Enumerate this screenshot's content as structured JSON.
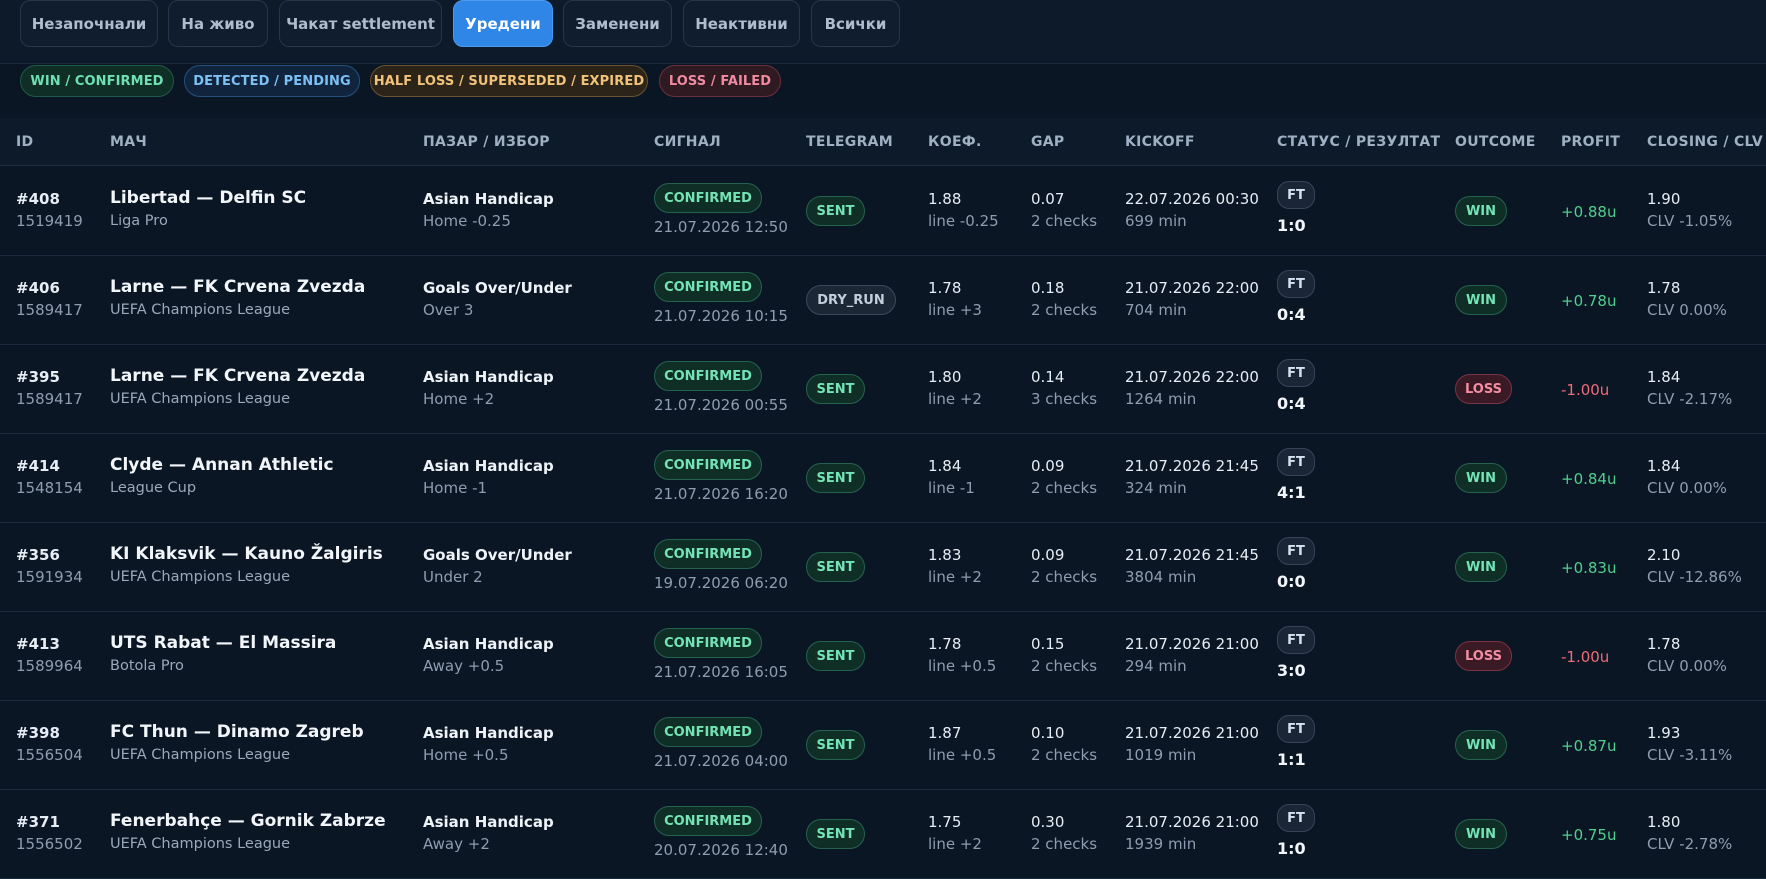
{
  "tabs": [
    {
      "label": "Незапочнали"
    },
    {
      "label": "На живо"
    },
    {
      "label": "Чакат settlement"
    },
    {
      "label": "Уредени",
      "active": true
    },
    {
      "label": "Заменени"
    },
    {
      "label": "Неактивни"
    },
    {
      "label": "Всички"
    }
  ],
  "legend": [
    {
      "label": "WIN / CONFIRMED"
    },
    {
      "label": "DETECTED / PENDING"
    },
    {
      "label": "HALF LOSS / SUPERSEDED / EXPIRED"
    },
    {
      "label": "LOSS / FAILED"
    }
  ],
  "columns": {
    "id": "ID",
    "match": "МАЧ",
    "market": "ПАЗАР / ИЗБОР",
    "signal": "СИГНАЛ",
    "telegram": "TELEGRAM",
    "odds": "КОЕФ.",
    "gap": "GAP",
    "kickoff": "KICKOFF",
    "status": "СТАТУС / РЕЗУЛТАТ",
    "outcome": "OUTCOME",
    "profit": "PROFIT",
    "closing": "CLOSING / CLV"
  },
  "colors": {
    "accent": "#2f86e6",
    "win": "#74e4b6",
    "loss": "#f48ca2",
    "profit_positive": "#4fd08e",
    "profit_negative": "#ef6a78"
  },
  "rows": [
    {
      "id": "#408",
      "event_id": "1519419",
      "match": "Libertad — Delfin SC",
      "league": "Liga Pro",
      "market": "Asian Handicap",
      "selection": "Home -0.25",
      "signal": "CONFIRMED",
      "signal_time": "21.07.2026 12:50",
      "telegram": "SENT",
      "odds": "1.88",
      "line": "line -0.25",
      "gap": "0.07",
      "checks": "2 checks",
      "kickoff": "22.07.2026 00:30",
      "minutes": "699 min",
      "status": "FT",
      "score": "1:0",
      "outcome": "WIN",
      "profit": "+0.88u",
      "closing": "1.90",
      "clv": "CLV -1.05%"
    },
    {
      "id": "#406",
      "event_id": "1589417",
      "match": "Larne — FK Crvena Zvezda",
      "league": "UEFA Champions League",
      "market": "Goals Over/Under",
      "selection": "Over 3",
      "signal": "CONFIRMED",
      "signal_time": "21.07.2026 10:15",
      "telegram": "DRY_RUN",
      "odds": "1.78",
      "line": "line +3",
      "gap": "0.18",
      "checks": "2 checks",
      "kickoff": "21.07.2026 22:00",
      "minutes": "704 min",
      "status": "FT",
      "score": "0:4",
      "outcome": "WIN",
      "profit": "+0.78u",
      "closing": "1.78",
      "clv": "CLV 0.00%"
    },
    {
      "id": "#395",
      "event_id": "1589417",
      "match": "Larne — FK Crvena Zvezda",
      "league": "UEFA Champions League",
      "market": "Asian Handicap",
      "selection": "Home +2",
      "signal": "CONFIRMED",
      "signal_time": "21.07.2026 00:55",
      "telegram": "SENT",
      "odds": "1.80",
      "line": "line +2",
      "gap": "0.14",
      "checks": "3 checks",
      "kickoff": "21.07.2026 22:00",
      "minutes": "1264 min",
      "status": "FT",
      "score": "0:4",
      "outcome": "LOSS",
      "profit": "-1.00u",
      "closing": "1.84",
      "clv": "CLV -2.17%"
    },
    {
      "id": "#414",
      "event_id": "1548154",
      "match": "Clyde — Annan Athletic",
      "league": "League Cup",
      "market": "Asian Handicap",
      "selection": "Home -1",
      "signal": "CONFIRMED",
      "signal_time": "21.07.2026 16:20",
      "telegram": "SENT",
      "odds": "1.84",
      "line": "line -1",
      "gap": "0.09",
      "checks": "2 checks",
      "kickoff": "21.07.2026 21:45",
      "minutes": "324 min",
      "status": "FT",
      "score": "4:1",
      "outcome": "WIN",
      "profit": "+0.84u",
      "closing": "1.84",
      "clv": "CLV 0.00%"
    },
    {
      "id": "#356",
      "event_id": "1591934",
      "match": "KI Klaksvik — Kauno Žalgiris",
      "league": "UEFA Champions League",
      "market": "Goals Over/Under",
      "selection": "Under 2",
      "signal": "CONFIRMED",
      "signal_time": "19.07.2026 06:20",
      "telegram": "SENT",
      "odds": "1.83",
      "line": "line +2",
      "gap": "0.09",
      "checks": "2 checks",
      "kickoff": "21.07.2026 21:45",
      "minutes": "3804 min",
      "status": "FT",
      "score": "0:0",
      "outcome": "WIN",
      "profit": "+0.83u",
      "closing": "2.10",
      "clv": "CLV -12.86%"
    },
    {
      "id": "#413",
      "event_id": "1589964",
      "match": "UTS Rabat — El Massira",
      "league": "Botola Pro",
      "market": "Asian Handicap",
      "selection": "Away +0.5",
      "signal": "CONFIRMED",
      "signal_time": "21.07.2026 16:05",
      "telegram": "SENT",
      "odds": "1.78",
      "line": "line +0.5",
      "gap": "0.15",
      "checks": "2 checks",
      "kickoff": "21.07.2026 21:00",
      "minutes": "294 min",
      "status": "FT",
      "score": "3:0",
      "outcome": "LOSS",
      "profit": "-1.00u",
      "closing": "1.78",
      "clv": "CLV 0.00%"
    },
    {
      "id": "#398",
      "event_id": "1556504",
      "match": "FC Thun — Dinamo Zagreb",
      "league": "UEFA Champions League",
      "market": "Asian Handicap",
      "selection": "Home +0.5",
      "signal": "CONFIRMED",
      "signal_time": "21.07.2026 04:00",
      "telegram": "SENT",
      "odds": "1.87",
      "line": "line +0.5",
      "gap": "0.10",
      "checks": "2 checks",
      "kickoff": "21.07.2026 21:00",
      "minutes": "1019 min",
      "status": "FT",
      "score": "1:1",
      "outcome": "WIN",
      "profit": "+0.87u",
      "closing": "1.93",
      "clv": "CLV -3.11%"
    },
    {
      "id": "#371",
      "event_id": "1556502",
      "match": "Fenerbahçe — Gornik Zabrze",
      "league": "UEFA Champions League",
      "market": "Asian Handicap",
      "selection": "Away +2",
      "signal": "CONFIRMED",
      "signal_time": "20.07.2026 12:40",
      "telegram": "SENT",
      "odds": "1.75",
      "line": "line +2",
      "gap": "0.30",
      "checks": "2 checks",
      "kickoff": "21.07.2026 21:00",
      "minutes": "1939 min",
      "status": "FT",
      "score": "1:0",
      "outcome": "WIN",
      "profit": "+0.75u",
      "closing": "1.80",
      "clv": "CLV -2.78%"
    }
  ]
}
